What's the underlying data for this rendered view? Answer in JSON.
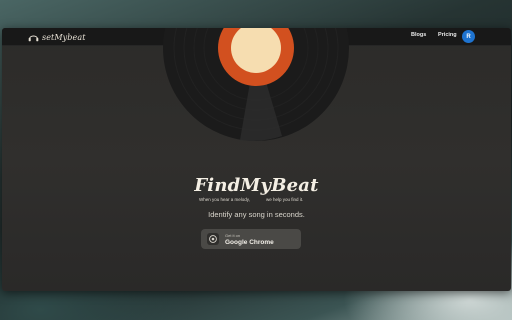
{
  "header": {
    "logo_text": "setMybeat",
    "nav": {
      "blogs": "Blogs",
      "pricing": "Pricing"
    },
    "avatar_initial": "R"
  },
  "hero": {
    "title": "FindMyBeat",
    "tagline_left": "When you hear a melody,",
    "tagline_right": "we help you find it.",
    "subtitle": "Identify any song in seconds.",
    "cta": {
      "small": "Get it on",
      "label": "Google Chrome"
    }
  },
  "colors": {
    "record_label": "#d2501f",
    "record_center": "#f6ddb0",
    "avatar": "#1e73d0"
  }
}
